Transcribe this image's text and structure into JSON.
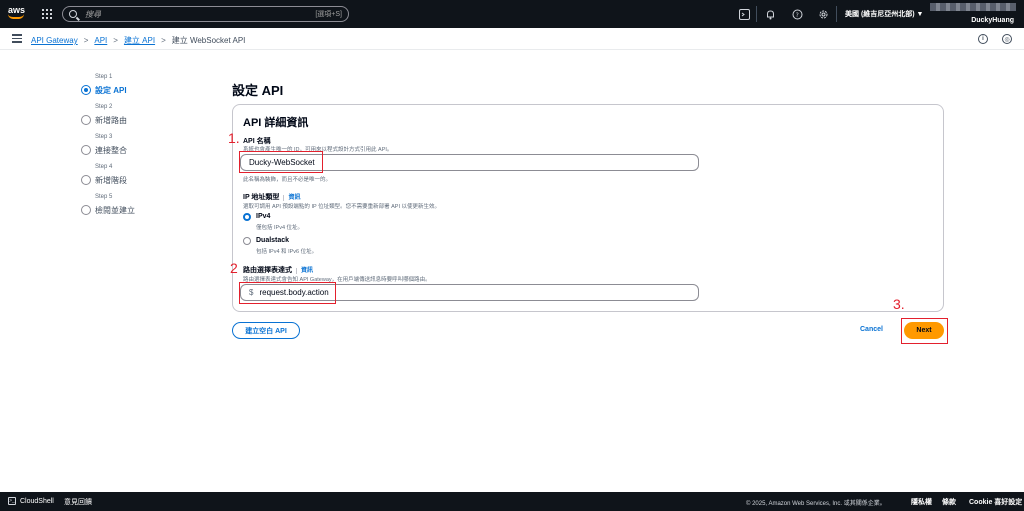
{
  "topnav": {
    "logo_text": "aws",
    "search_placeholder": "搜尋",
    "search_shortcut": "[選項+S]",
    "region": "美國 (維吉尼亞州北部) ▼",
    "user": "DuckyHuang"
  },
  "breadcrumb": {
    "items": [
      "API Gateway",
      "API",
      "建立 API"
    ],
    "current": "建立 WebSocket API",
    "separator": ">"
  },
  "steps": [
    {
      "num": "Step 1",
      "label": "設定 API",
      "active": true
    },
    {
      "num": "Step 2",
      "label": "新增路由",
      "active": false
    },
    {
      "num": "Step 3",
      "label": "連接整合",
      "active": false
    },
    {
      "num": "Step 4",
      "label": "新增階段",
      "active": false
    },
    {
      "num": "Step 5",
      "label": "檢閱並建立",
      "active": false
    }
  ],
  "main": {
    "title": "設定 API",
    "panel_title": "API 詳細資訊",
    "api_name": {
      "label": "API 名稱",
      "description": "系統也會產生唯一的 ID，可用來以程式設計方式引用此 API。",
      "value": "Ducky-WebSocket",
      "hint": "此名稱為裝飾，而且不必是唯一的。"
    },
    "ip_type": {
      "label": "IP 地址類型",
      "info": "資訊",
      "description": "選取可調用 API 預設端點的 IP 位址類型。您不需要重新部署 API 以使更新生效。",
      "options": [
        {
          "label": "IPv4",
          "desc": "僅包括 IPv4 位址。",
          "selected": true
        },
        {
          "label": "Dualstack",
          "desc": "包括 IPv4 和 IPv6 位址。",
          "selected": false
        }
      ]
    },
    "route_expr": {
      "label": "路由選擇表達式",
      "info": "資訊",
      "description": "路由選擇表達式會告知 API Gateway，在用戶端傳送訊息時要呼叫哪個路由。",
      "prefix": "$",
      "value": "request.body.action"
    },
    "annotations": [
      "1.",
      "2",
      "3."
    ]
  },
  "buttons": {
    "create_blank": "建立空白 API",
    "cancel": "Cancel",
    "next": "Next"
  },
  "footer": {
    "cloudshell": "CloudShell",
    "feedback": "意見回饋",
    "copyright": "© 2025, Amazon Web Services, Inc. 或其關係企業。",
    "privacy": "隱私權",
    "terms": "條款",
    "cookie": "Cookie 喜好設定"
  }
}
